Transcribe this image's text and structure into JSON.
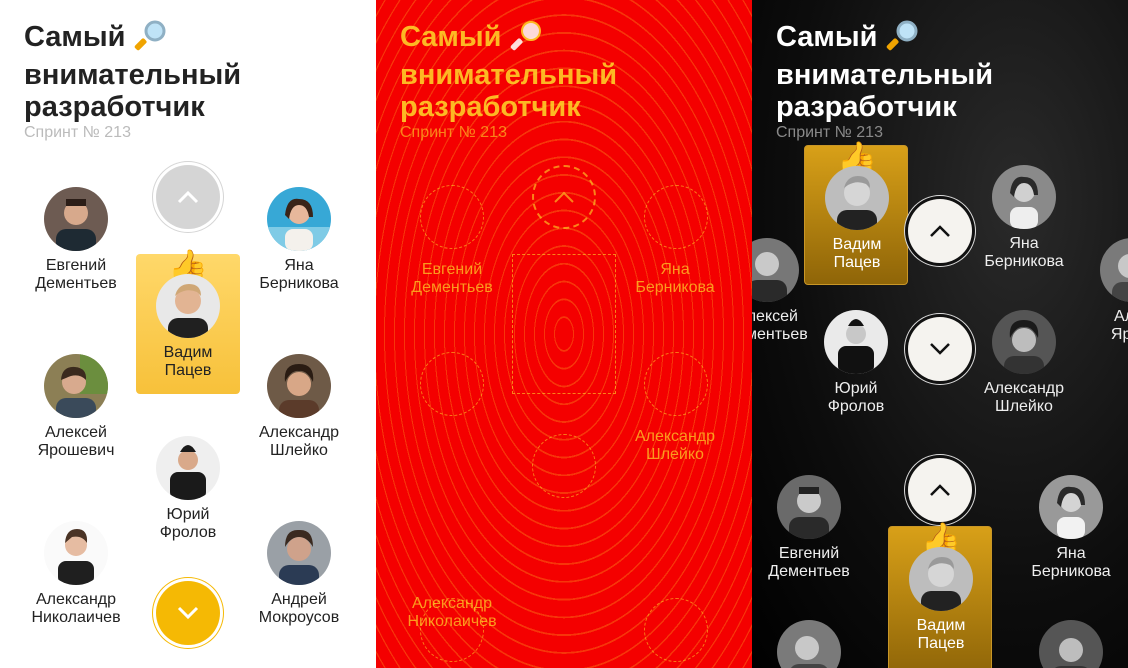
{
  "title_line1": "Самый",
  "title_line2": "внимательный",
  "title_line3": "разработчик",
  "subtitle": "Спринт № 213",
  "magnifier_icon": "magnifier-icon",
  "thumb_icon": "thumbs-up-icon",
  "thumb_glyph": "👍",
  "chevron_up_icon": "chevron-up-icon",
  "chevron_down_icon": "chevron-down-icon",
  "colors": {
    "accent": "#f5b904",
    "highlight": "#ffd86a",
    "dark_bg": "#0d0d0d",
    "glitch_red": "#f40000"
  },
  "people": {
    "evgeniy": "Евгений\nДементьев",
    "yana": "Яна\nБерникова",
    "vadim": "Вадим\nПацев",
    "aleksey": "Алексей\nЯрошевич",
    "aleksandr_sh": "Александр\nШлейко",
    "yuriy": "Юрий\nФролов",
    "aleksandr_n": "Александр\nНиколаичев",
    "andrey": "Андрей\nМокроусов",
    "evgeniy_cut": "Алексей\nДементьев",
    "aleksey_cut": "Алек\nЯрош"
  }
}
